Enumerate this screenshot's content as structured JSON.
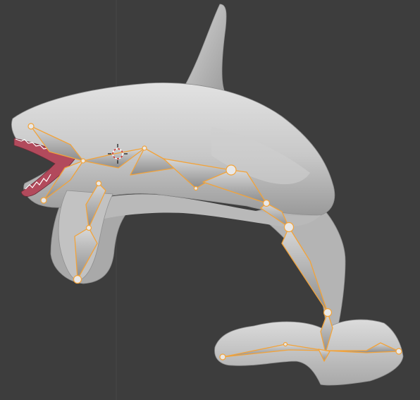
{
  "viewport": {
    "background_color": "#3d3d3d",
    "grid_line_color": "#4a4a4a",
    "selected_bone_outline_color": "#f2a33a",
    "joint_color": "#e8e8e8",
    "mesh_light_color": "#d0d0d0",
    "mesh_shadow_color": "#8a8a8a",
    "mouth_color": "#b24a5c",
    "icons": [
      "3d-cursor-icon"
    ]
  }
}
